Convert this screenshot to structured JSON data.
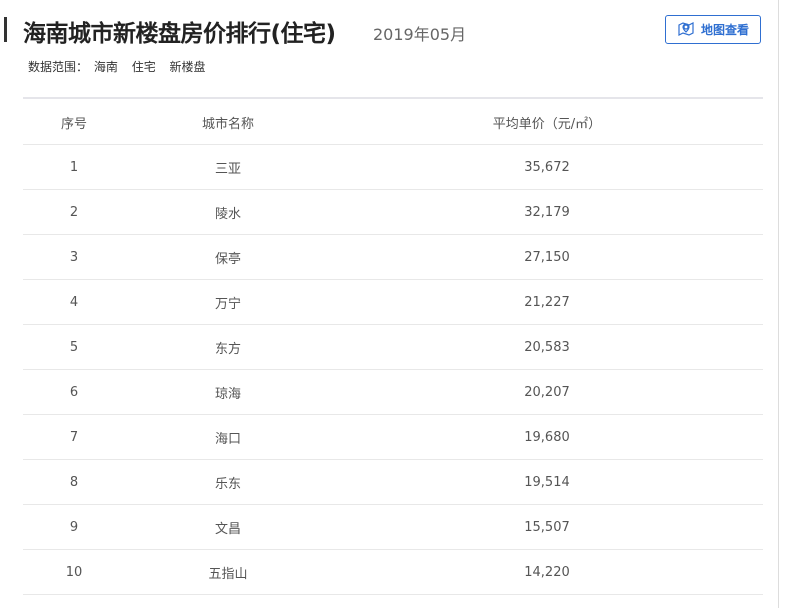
{
  "header": {
    "title": "海南城市新楼盘房价排行(住宅)",
    "date": "2019年05月",
    "map_button": "地图查看"
  },
  "scope": {
    "label": "数据范围：",
    "tags": [
      "海南",
      "住宅",
      "新楼盘"
    ]
  },
  "table": {
    "columns": [
      "序号",
      "城市名称",
      "平均单价（元/㎡）"
    ],
    "rows": [
      [
        "1",
        "三亚",
        "35,672"
      ],
      [
        "2",
        "陵水",
        "32,179"
      ],
      [
        "3",
        "保亭",
        "27,150"
      ],
      [
        "4",
        "万宁",
        "21,227"
      ],
      [
        "5",
        "东方",
        "20,583"
      ],
      [
        "6",
        "琼海",
        "20,207"
      ],
      [
        "7",
        "海口",
        "19,680"
      ],
      [
        "8",
        "乐东",
        "19,514"
      ],
      [
        "9",
        "文昌",
        "15,507"
      ],
      [
        "10",
        "五指山",
        "14,220"
      ]
    ]
  },
  "colors": {
    "accent": "#2f6fd1"
  }
}
